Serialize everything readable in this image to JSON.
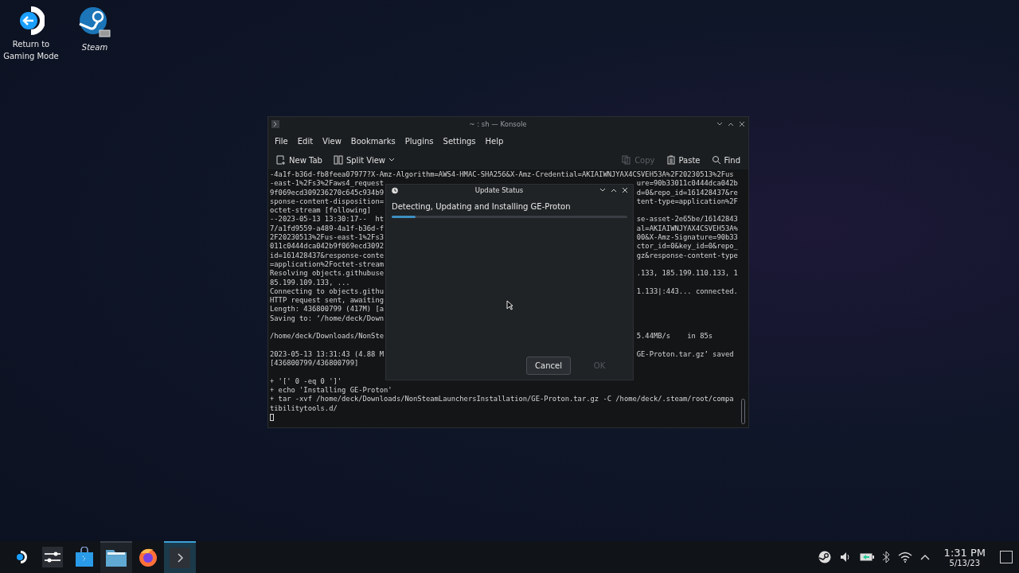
{
  "desktop_icons": [
    {
      "kind": "return",
      "label": "Return to Gaming Mode"
    },
    {
      "kind": "shortcut",
      "label": "Steam"
    }
  ],
  "konsole": {
    "title": "~ : sh — Konsole",
    "menu": [
      "File",
      "Edit",
      "View",
      "Bookmarks",
      "Plugins",
      "Settings",
      "Help"
    ],
    "toolbar": [
      {
        "kind": "newtab",
        "label": "New Tab",
        "disabled": false
      },
      {
        "kind": "split",
        "label": "Split View",
        "disabled": false
      },
      {
        "kind": "copy",
        "label": "Copy",
        "disabled": true
      },
      {
        "kind": "paste",
        "label": "Paste",
        "disabled": false
      },
      {
        "kind": "find",
        "label": "Find",
        "disabled": false
      }
    ],
    "terminal_blocks": [
      [
        {
          "left": "-4a1f-b36d-fb8feea07977?X-Amz-Algorithm=AWS4-HMAC-SHA256&X-Amz-Credential=AKIAIWNJYAX4CSVEH53A%2F20230513%2Fus"
        },
        {
          "left": "-east-1%2Fs3%2Faws4_request",
          "right": "ure=90b33011c0444dca042b"
        },
        {
          "left": "9f069ecd309236270c645c934b9",
          "right": "d=0&repo_id=161428437&re"
        },
        {
          "left": "sponse-content-disposition=",
          "right": "tent-type=application%2F"
        },
        {
          "left": "octet-stream [following]"
        },
        {
          "left": "--2023-05-13 13:30:17--  ht",
          "right": "se-asset-2e65be/16142843"
        },
        {
          "left": "7/a1fd9559-a489-4a1f-b36d-f",
          "right": "al=AKIAIWNJYAX4CSVEH53A%"
        },
        {
          "left": "2F20230513%2Fus-east-1%2Fs3",
          "right": "00&X-Amz-Signature=90b33"
        },
        {
          "left": "011c0444dca042b9f069ecd3092",
          "right": "ctor_id=0&key_id=0&repo_"
        },
        {
          "left": "id=161428437&response-conte",
          "right": "gz&response-content-type"
        },
        {
          "left": "=application%2Foctet-stream"
        },
        {
          "left": "Resolving objects.githubuse",
          "right": ".133, 185.199.110.133, 1"
        },
        {
          "left": "85.199.109.133, ..."
        },
        {
          "left": "Connecting to objects.githu",
          "right": "1.133|:443... connected."
        },
        {
          "left": "HTTP request sent, awaiting"
        },
        {
          "left": "Length: 436800799 (417M) [a"
        },
        {
          "left": "Saving to: ‘/home/deck/Down"
        }
      ],
      [
        {
          "left": "/home/deck/Downloads/NonSte",
          "right": "5.44MB/s    in 85s"
        }
      ],
      [
        {
          "left": "2023-05-13 13:31:43 (4.88 M",
          "right": "GE-Proton.tar.gz’ saved"
        },
        {
          "left": "[436800799/436800799]"
        }
      ],
      [
        {
          "left": "+ '[' 0 -eq 0 ']'"
        },
        {
          "left": "+ echo 'Installing GE-Proton'"
        },
        {
          "left": "+ tar -xvf /home/deck/Downloads/NonSteamLaunchersInstallation/GE-Proton.tar.gz -C /home/deck/.steam/root/compa"
        },
        {
          "left": "tibilitytools.d/"
        }
      ]
    ]
  },
  "dialog": {
    "title": "Update Status",
    "message": "Detecting, Updating and Installing GE-Proton",
    "progress": {
      "level": 0.1
    },
    "buttons": [
      {
        "label": "Cancel",
        "disabled": false
      },
      {
        "label": "OK",
        "disabled": true
      }
    ]
  },
  "taskbar": {
    "items": [
      {
        "kind": "launcher",
        "open": false,
        "selected": false
      },
      {
        "kind": "settings",
        "open": false,
        "selected": false
      },
      {
        "kind": "store",
        "open": false,
        "selected": false
      },
      {
        "kind": "files",
        "open": true,
        "selected": false
      },
      {
        "kind": "browser",
        "open": false,
        "selected": false
      },
      {
        "kind": "terminal",
        "open": true,
        "selected": true
      }
    ],
    "clock": {
      "time": "1:31 PM",
      "date": "5/13/23"
    }
  }
}
